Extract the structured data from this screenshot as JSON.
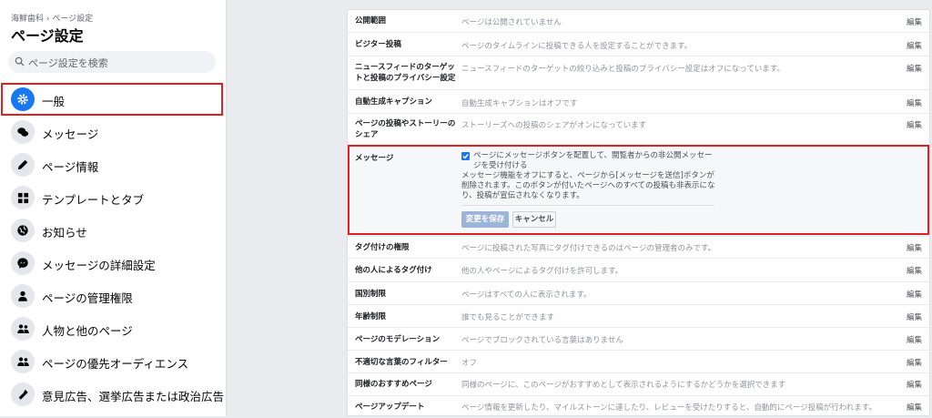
{
  "sidebar": {
    "breadcrumb": "海鮮歯科 › ページ設定",
    "title": "ページ設定",
    "search_placeholder": "ページ設定を検索",
    "items": [
      {
        "label": "一般",
        "icon": "gear-icon"
      },
      {
        "label": "メッセージ",
        "icon": "chat-icon"
      },
      {
        "label": "ページ情報",
        "icon": "pencil-icon"
      },
      {
        "label": "テンプレートとタブ",
        "icon": "grid-icon"
      },
      {
        "label": "お知らせ",
        "icon": "globe-icon"
      },
      {
        "label": "メッセージの詳細設定",
        "icon": "messenger-icon"
      },
      {
        "label": "ページの管理権限",
        "icon": "person-icon"
      },
      {
        "label": "人物と他のページ",
        "icon": "people-icon"
      },
      {
        "label": "ページの優先オーディエンス",
        "icon": "people-icon"
      },
      {
        "label": "意見広告、選挙広告または政治広告",
        "icon": "megaphone-icon"
      }
    ]
  },
  "settings": {
    "edit_label": "編集",
    "rows_top": [
      {
        "label": "公開範囲",
        "desc": "ページは公開されていません"
      },
      {
        "label": "ビジター投稿",
        "desc": "ページのタイムラインに投稿できる人を設定することができます。"
      },
      {
        "label": "ニュースフィードのターゲットと投稿のプライバシー設定",
        "desc": "ニュースフィードのターゲットの絞り込みと投稿のプライバシー設定はオフになっています。"
      },
      {
        "label": "自動生成キャプション",
        "desc": "自動生成キャプションはオフです"
      },
      {
        "label": "ページの投稿やストーリーのシェア",
        "desc": "ストーリーズへの投稿のシェアがオンになっています"
      }
    ],
    "message": {
      "label": "メッセージ",
      "checkbox_text_1": "ページにメッセージボタンを配置して、閲覧者からの非公開メッセー",
      "checkbox_text_2": "ジを受け付ける",
      "note_1": "メッセージ機能をオフにすると、ページから[メッセージを送信]ボタンが",
      "note_2": "削除されます。このボタンが付いたページへのすべての投稿も非表示にな",
      "note_3": "り、投稿が宣伝されなくなります。",
      "save_label": "変更を保存",
      "cancel_label": "キャンセル"
    },
    "rows_bottom": [
      {
        "label": "タグ付けの権限",
        "desc": "ページに投稿された写真にタグ付けできるのはページの管理者のみです。"
      },
      {
        "label": "他の人によるタグ付け",
        "desc": "他の人やページによるタグ付けを許可します。"
      },
      {
        "label": "国別制限",
        "desc": "ページはすべての人に表示されます。"
      },
      {
        "label": "年齢制限",
        "desc": "誰でも見ることができます"
      },
      {
        "label": "ページのモデレーション",
        "desc": "ページでブロックされている言葉はありません"
      },
      {
        "label": "不適切な言葉のフィルター",
        "desc": "オフ"
      },
      {
        "label": "同様のおすすめページ",
        "desc": "同様のページに、このページがおすすめとして表示されるようにするかどうかを選択できます"
      },
      {
        "label": "ページアップデート",
        "desc": "ページ情報を更新したり、マイルストーンに達したり、レビューを受けたりすると、自動的にページ投稿が行われます。"
      }
    ]
  },
  "colors": {
    "accent": "#1877f2",
    "highlight": "#e0211f"
  }
}
